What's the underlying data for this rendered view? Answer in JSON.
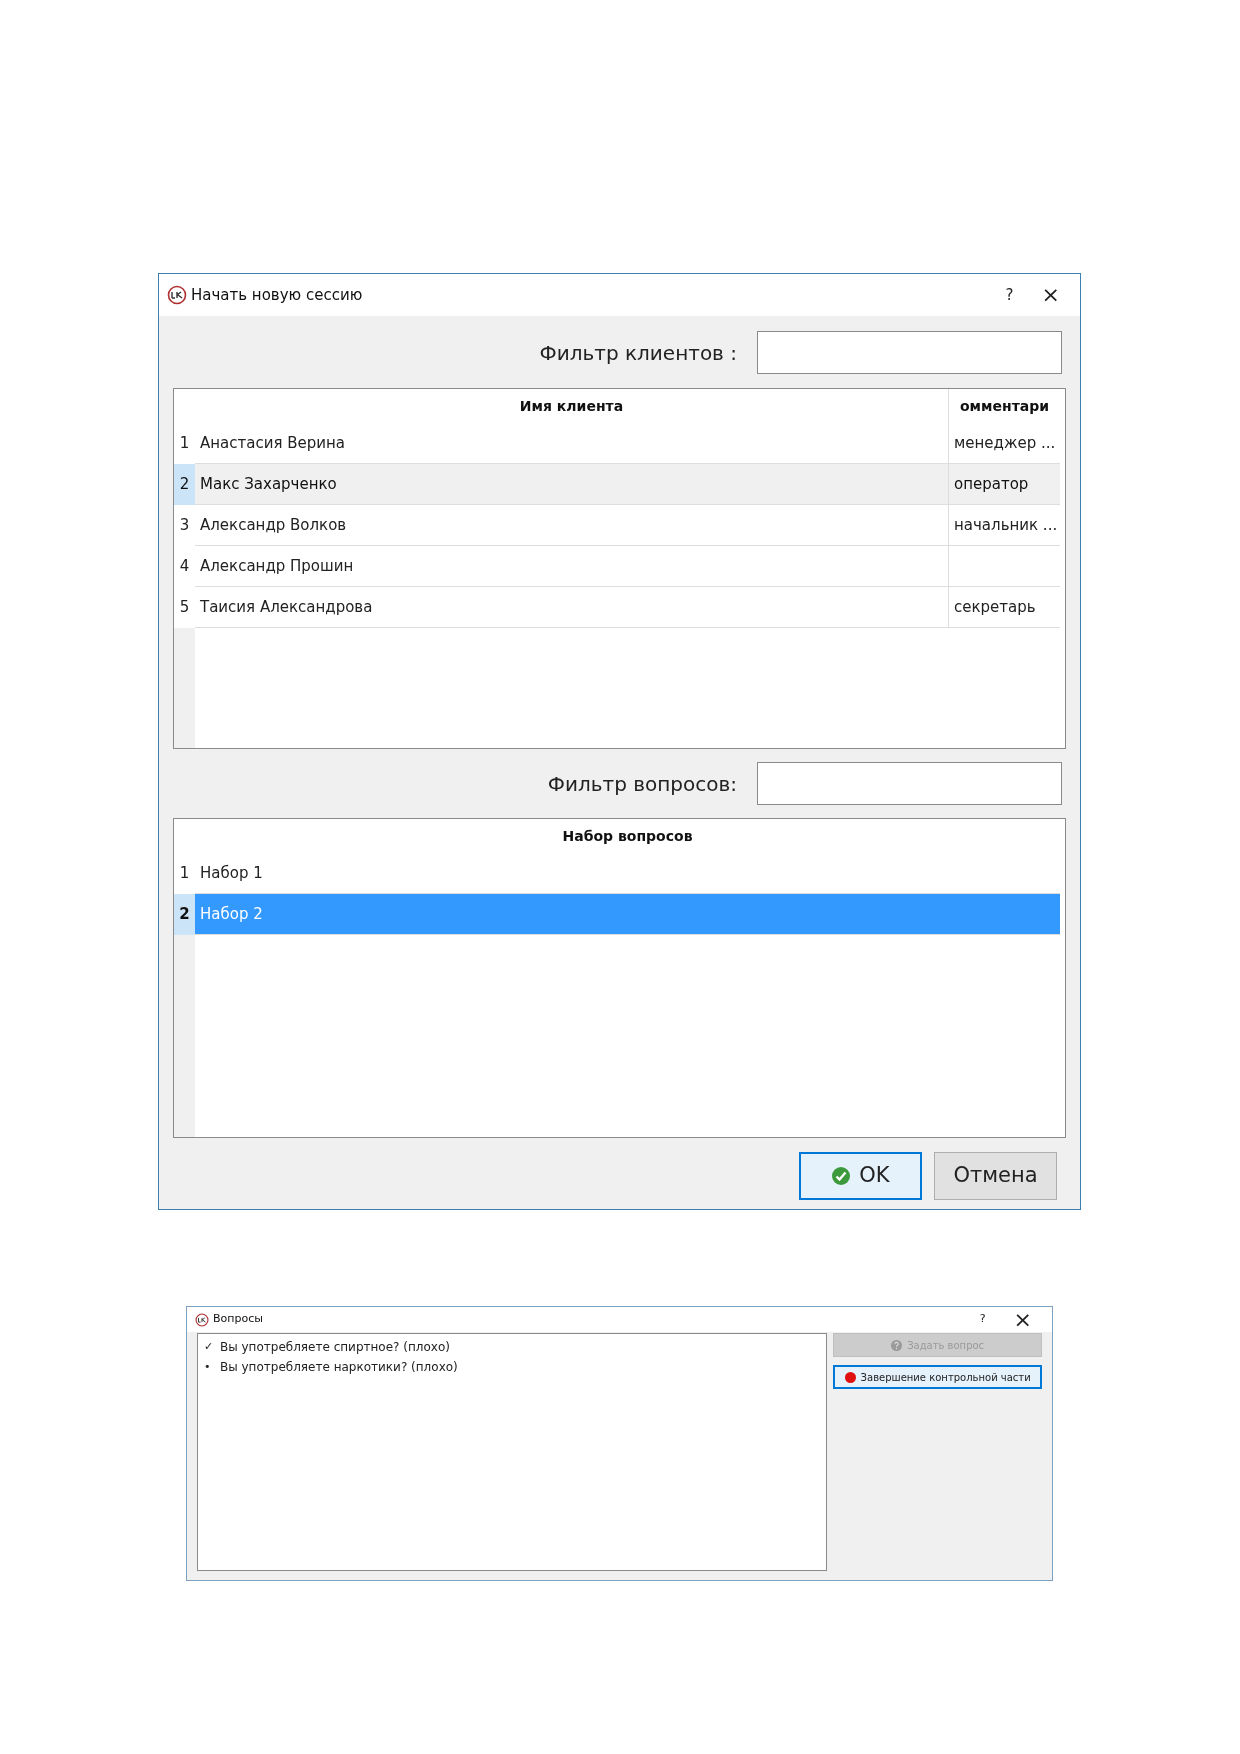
{
  "session_dialog": {
    "title": "Начать новую сессию",
    "help": "?",
    "close": "×",
    "client_filter": {
      "label": "Фильтр клиентов :"
    },
    "clients_table": {
      "columns": [
        "Имя клиента",
        "омментари"
      ],
      "rows": [
        {
          "number": "1",
          "name": "Анастасия Верина",
          "comment": "менеджер ...",
          "selected": false
        },
        {
          "number": "2",
          "name": "Макс Захарченко",
          "comment": "оператор",
          "selected": true
        },
        {
          "number": "3",
          "name": "Александр Волков",
          "comment": "начальник ...",
          "selected": false
        },
        {
          "number": "4",
          "name": "Александр Прошин",
          "comment": "",
          "selected": false
        },
        {
          "number": "5",
          "name": "Таисия Александрова",
          "comment": "секретарь",
          "selected": false
        }
      ]
    },
    "question_filter": {
      "label": "Фильтр вопросов:"
    },
    "sets_table": {
      "columns": [
        "Набор вопросов"
      ],
      "rows": [
        {
          "number": "1",
          "name": "Набор 1",
          "selected": false
        },
        {
          "number": "2",
          "name": "Набор 2",
          "selected": true
        }
      ]
    },
    "buttons": [
      {
        "label": "OK",
        "default": true
      },
      {
        "label": "Отмена",
        "default": false
      }
    ]
  },
  "questions_dialog": {
    "title": "Вопросы",
    "help": "?",
    "close": "×",
    "questions": [
      {
        "marker": "✓",
        "text": "Вы употребляете спиртное? (плохо)"
      },
      {
        "marker": "•",
        "text": "Вы употребляете наркотики? (плохо)"
      }
    ],
    "buttons": [
      {
        "kind": "ask",
        "label": "Задать вопрос",
        "disabled": true
      },
      {
        "kind": "finish",
        "label": "Завершение контрольной части",
        "disabled": false
      }
    ]
  }
}
